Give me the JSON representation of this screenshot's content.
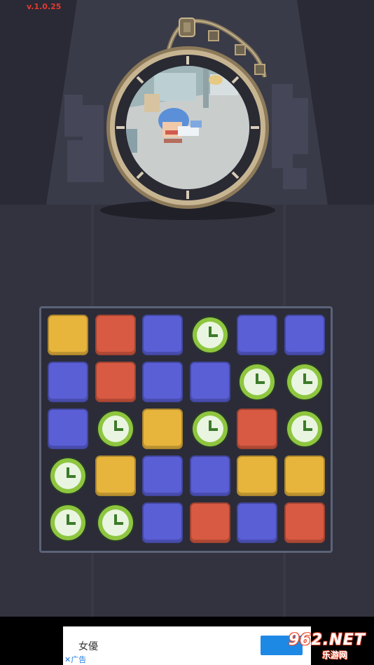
{
  "version": "v.1.0.25",
  "colors": {
    "yellow": "#e8b53c",
    "red": "#d85a42",
    "blue": "#5a5fd6",
    "clock_ring": "#8ec63f",
    "clock_face": "#e9f5e0"
  },
  "board": {
    "rows": 5,
    "cols": 6,
    "tiles": [
      [
        "yellow",
        "red",
        "blue",
        "clock",
        "blue",
        "blue"
      ],
      [
        "blue",
        "red",
        "blue",
        "blue",
        "clock",
        "clock"
      ],
      [
        "blue",
        "clock",
        "yellow",
        "clock",
        "red",
        "clock"
      ],
      [
        "clock",
        "yellow",
        "blue",
        "blue",
        "yellow",
        "yellow"
      ],
      [
        "clock",
        "clock",
        "blue",
        "red",
        "blue",
        "red"
      ]
    ]
  },
  "ad": {
    "title": "女優",
    "label": "广告"
  },
  "watermark": {
    "main": "962.NET",
    "sub": "乐游网"
  }
}
